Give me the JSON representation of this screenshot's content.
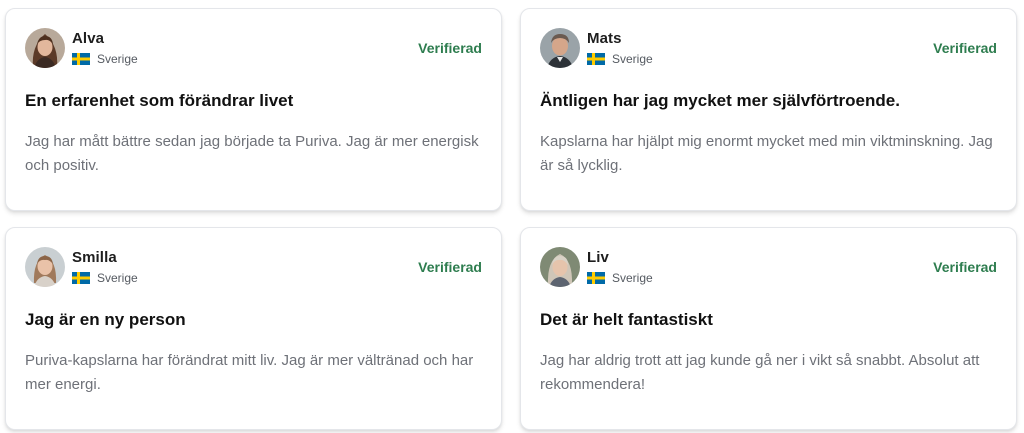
{
  "reviews": [
    {
      "name": "Alva",
      "country": "Sverige",
      "badge": "Verifierad",
      "title": "En erfarenhet som förändrar livet",
      "text": "Jag har mått bättre sedan jag började ta Puriva. Jag är mer energisk och positiv."
    },
    {
      "name": "Mats",
      "country": "Sverige",
      "badge": "Verifierad",
      "title": "Äntligen har jag mycket mer självförtroende.",
      "text": "Kapslarna har hjälpt mig enormt mycket med min viktminskning. Jag är så lycklig."
    },
    {
      "name": "Smilla",
      "country": "Sverige",
      "badge": "Verifierad",
      "title": "Jag är en ny person",
      "text": "Puriva-kapslarna har förändrat mitt liv. Jag är mer vältränad och har mer energi."
    },
    {
      "name": "Liv",
      "country": "Sverige",
      "badge": "Verifierad",
      "title": "Det är helt fantastiskt",
      "text": "Jag har aldrig trott att jag kunde gå ner i vikt så snabbt. Absolut att rekommendera!"
    }
  ],
  "colors": {
    "verified": "#2e7d4f",
    "title": "#111111",
    "body": "#6e7178",
    "flag_blue": "#006aa7",
    "flag_yellow": "#fecc00"
  },
  "icons": {
    "flag": "sweden-flag-icon",
    "avatar": "user-avatar"
  }
}
